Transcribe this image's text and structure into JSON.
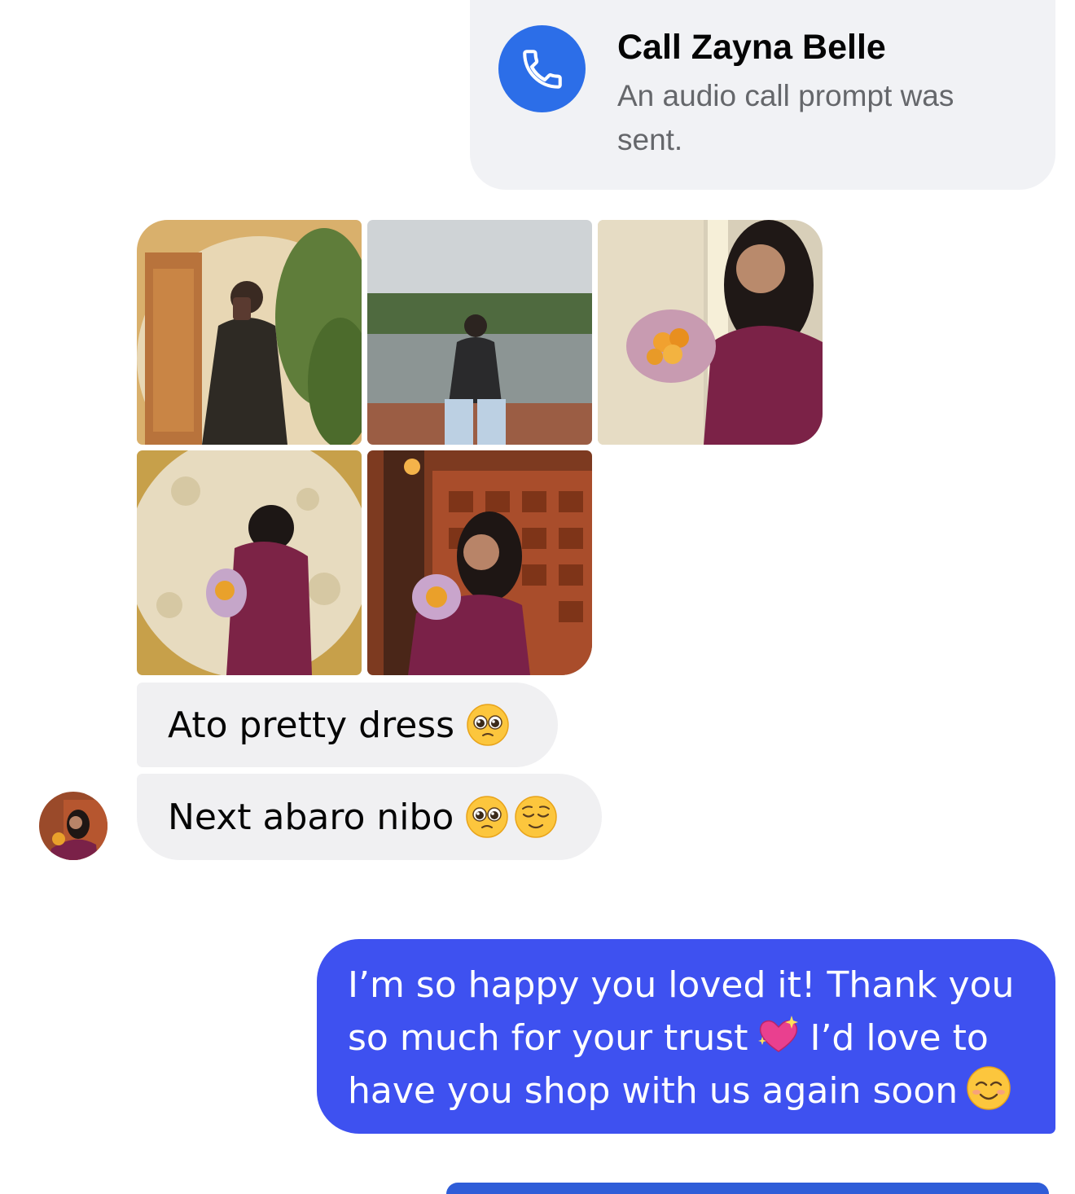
{
  "call_card": {
    "title": "Call Zayna Belle",
    "subtitle": "An audio call prompt was sent.",
    "icon": "phone-icon",
    "accent_color": "#2c6ee8"
  },
  "photos": [
    {
      "name": "photo-mirror-selfie"
    },
    {
      "name": "photo-lakeside"
    },
    {
      "name": "photo-bouquet-portrait"
    },
    {
      "name": "photo-moon-wall"
    },
    {
      "name": "photo-wooden-door"
    }
  ],
  "incoming": [
    {
      "text": "Ato pretty dress",
      "emojis": [
        "pleading-face"
      ]
    },
    {
      "text": "Next abaro nibo",
      "emojis": [
        "pleading-face",
        "relieved-face"
      ]
    }
  ],
  "outgoing": {
    "line1": "I’m so happy you loved it! Thank you",
    "line2a": "so much for your trust",
    "line2b": "I’d love to",
    "line3": "have you shop with us again soon",
    "emojis": [
      "sparkling-heart",
      "smiling-face"
    ],
    "color": "#3e51f0"
  }
}
